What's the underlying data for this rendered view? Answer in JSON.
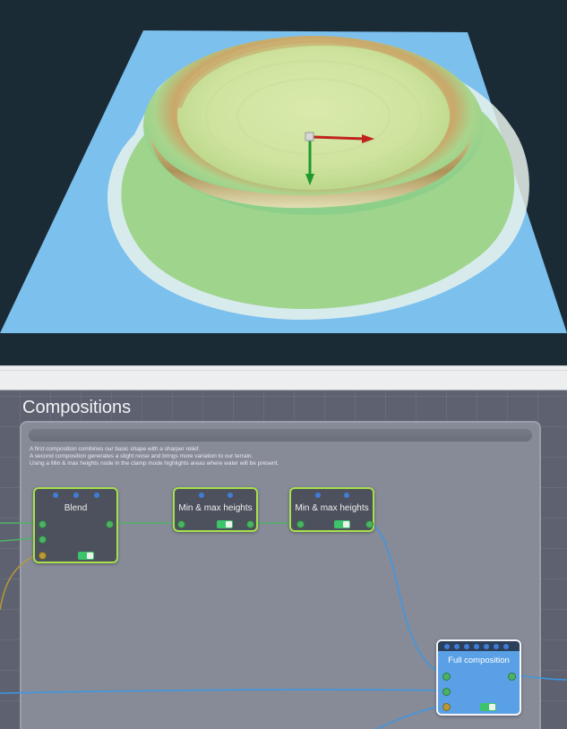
{
  "graph": {
    "title": "Compositions",
    "group": {
      "description": [
        "A first composition combines our basic shape with a sharper relief.",
        "A second composition generates a slight noise and brings more variation to our terrain.",
        "Using a Min & max heights node in the clamp mode highlights areas where water will be present."
      ]
    },
    "nodes": {
      "blend": {
        "title": "Blend"
      },
      "minmax1": {
        "title": "Min & max heights"
      },
      "minmax2": {
        "title": "Min & max heights"
      },
      "full": {
        "title": "Full composition"
      }
    }
  },
  "colors": {
    "viewport_background": "#1b2b35",
    "water": "#7cc0ee",
    "node_border": "#a7e04c",
    "wire_green": "#4fb565",
    "wire_blue": "#3c97e4",
    "wire_gold": "#b99a35",
    "gizmo_x": "#c0231e",
    "gizmo_y": "#1e9a2a"
  }
}
